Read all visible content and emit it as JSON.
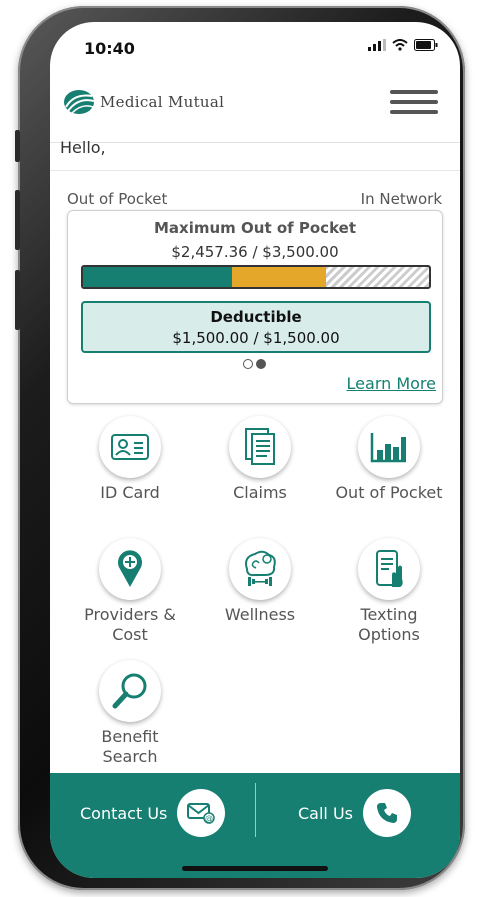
{
  "status_bar": {
    "time": "10:40"
  },
  "header": {
    "brand": "Medical Mutual",
    "menu_icon": "hamburger-menu-icon"
  },
  "greeting": "Hello,",
  "summary": {
    "left_label": "Out of Pocket",
    "right_label": "In Network",
    "max_title": "Maximum Out of Pocket",
    "max_amount": "$2,457.36 / $3,500.00",
    "deductible_title": "Deductible",
    "deductible_amount": "$1,500.00 / $1,500.00",
    "deductible_met_fraction": 1.0,
    "max_met_fraction": 0.702,
    "bar_teal_fraction": 0.43,
    "learn_more": "Learn More",
    "carousel_pages": 2,
    "carousel_active": 2
  },
  "tiles": [
    {
      "label": "ID Card",
      "icon": "id-card-icon"
    },
    {
      "label": "Claims",
      "icon": "claims-document-icon"
    },
    {
      "label": "Out of Pocket",
      "icon": "bar-chart-icon"
    },
    {
      "label": "Providers & Cost",
      "icon": "location-pin-plus-icon"
    },
    {
      "label": "Wellness",
      "icon": "wellness-brain-dumbbell-icon"
    },
    {
      "label": "Texting Options",
      "icon": "phone-text-icon"
    },
    {
      "label": "Benefit Search",
      "icon": "magnifier-icon"
    }
  ],
  "footer": {
    "contact": "Contact Us",
    "call": "Call Us"
  },
  "colors": {
    "brand": "#167f72",
    "accent": "#e4a72a",
    "deductible_bg": "#d8ecea"
  }
}
